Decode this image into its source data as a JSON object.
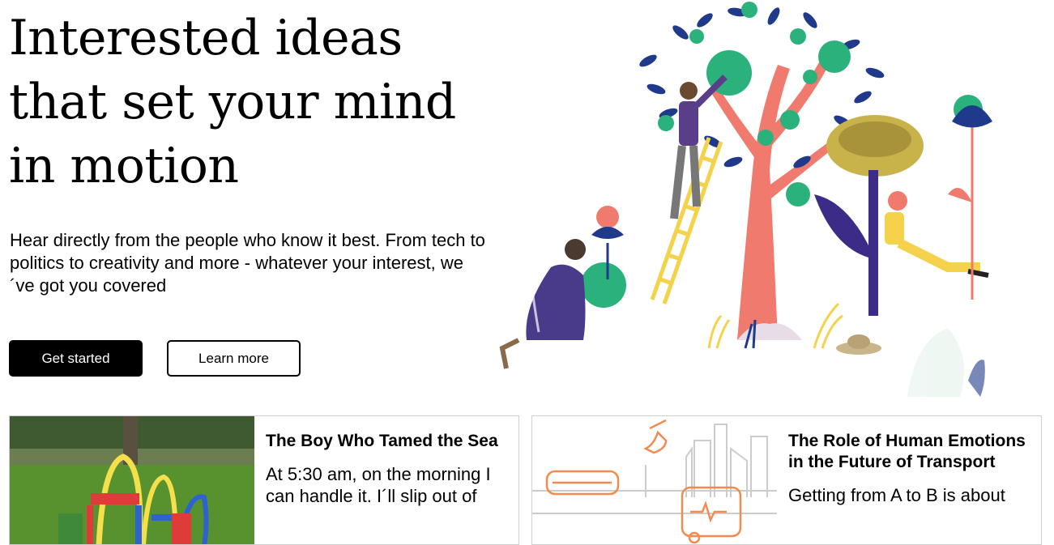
{
  "hero": {
    "title": "Interested ideas that set your mind in motion",
    "subtitle": "Hear directly from the people who know it best. From tech to politics to creativity and more - whatever your interest, we´ve got you covered",
    "primary_button": "Get started",
    "secondary_button": "Learn more"
  },
  "cards": [
    {
      "title": "The Boy Who Tamed the Sea",
      "excerpt": "At 5:30 am, on the morning I can handle it. I´ll slip out of",
      "image_icon": "playground-photo"
    },
    {
      "title": "The Role of Human Emotions in the Future of Transport",
      "excerpt": "Getting from A to B is about",
      "image_icon": "transport-illustration"
    }
  ],
  "colors": {
    "accent_coral": "#f07a6e",
    "accent_navy": "#1f3a8a",
    "accent_green": "#2bb17c",
    "accent_yellow": "#f4d24b",
    "accent_orange": "#f28b50"
  }
}
